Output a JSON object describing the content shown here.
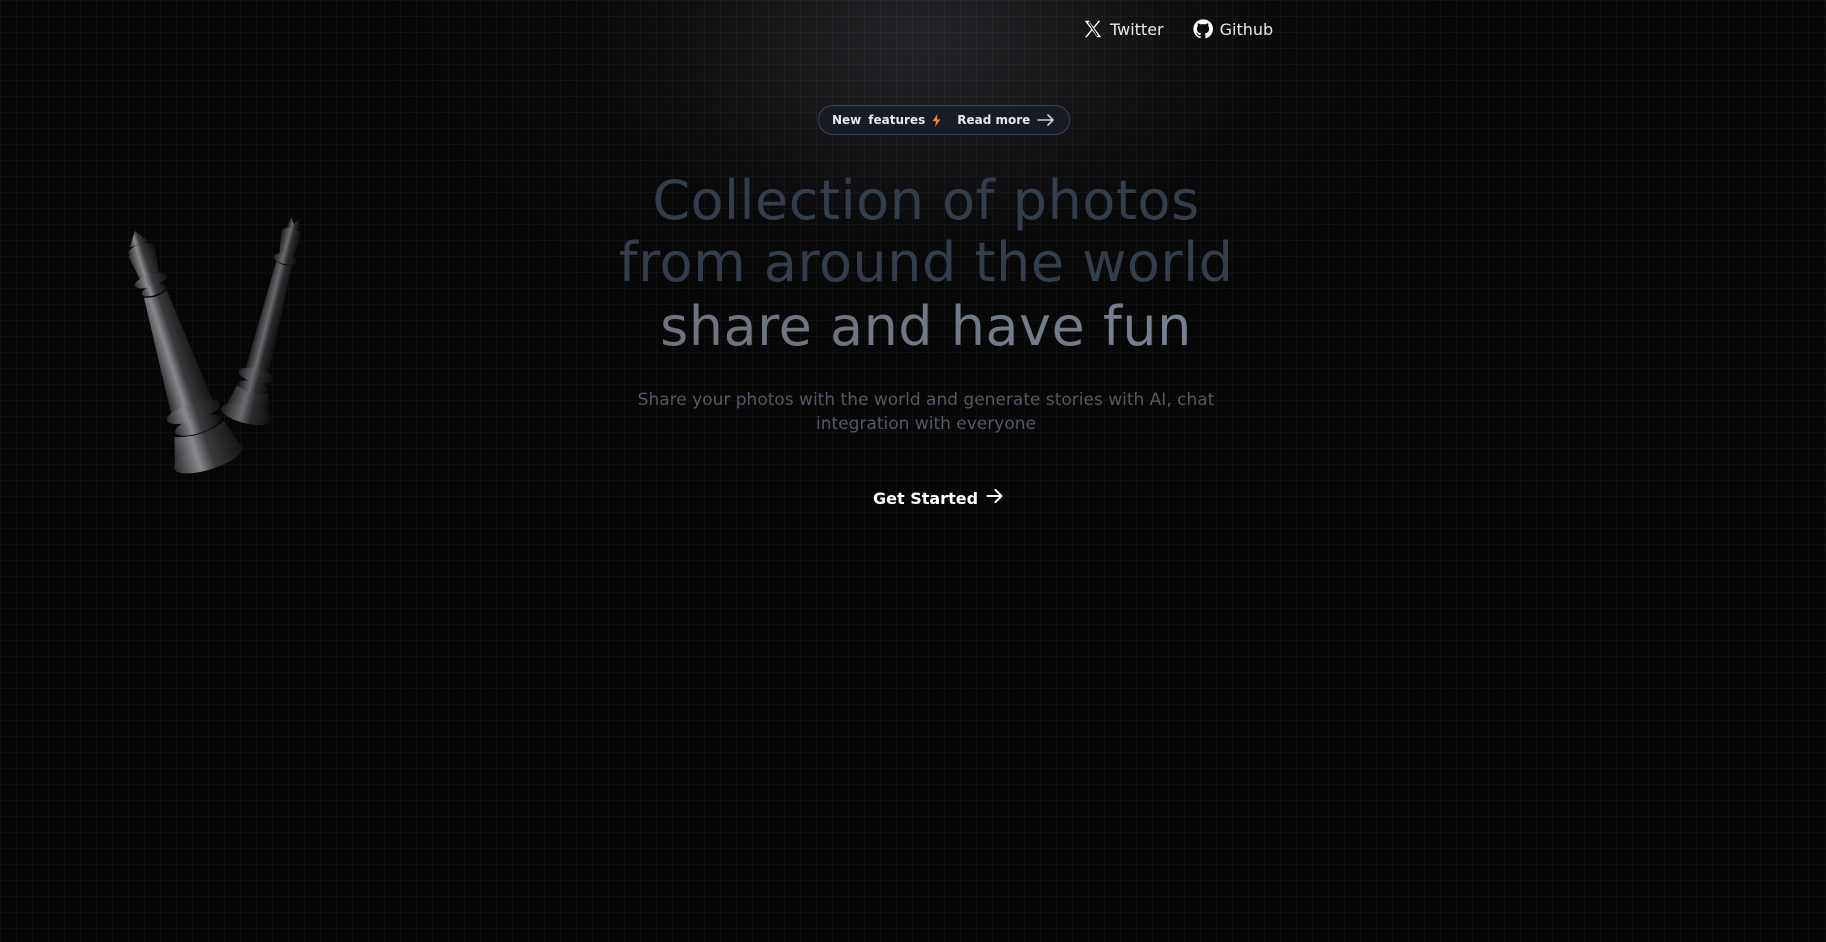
{
  "nav": {
    "links": [
      {
        "label": "Twitter",
        "icon": "x-twitter-icon"
      },
      {
        "label": "Github",
        "icon": "github-icon"
      }
    ]
  },
  "badge": {
    "new": "New",
    "features": "features",
    "bolt_icon": "lightning-bolt-icon",
    "read_more": "Read more",
    "accent_color": "#f5802a"
  },
  "hero": {
    "line1": "Collection of photos",
    "line2": "from around the world",
    "line3": "share and have fun",
    "subtitle": "Share your photos with the world and generate stories with AI, chat integration with everyone",
    "cta_label": "Get Started"
  },
  "colors": {
    "background": "#050505",
    "headline_dim": "#343d4b",
    "subtitle": "#525a66"
  }
}
